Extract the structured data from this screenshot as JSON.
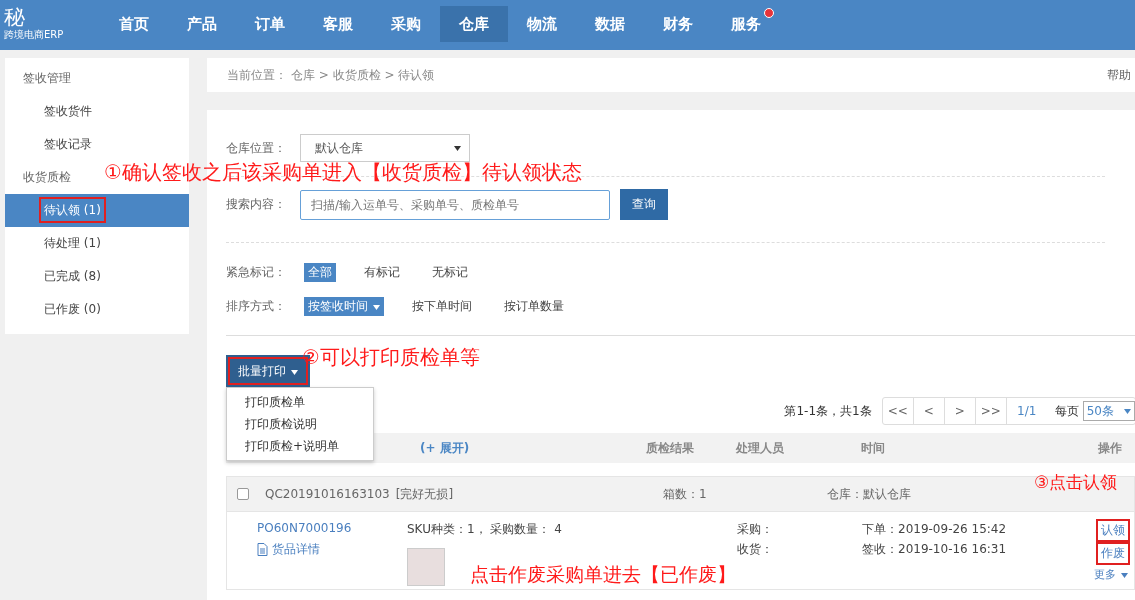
{
  "nav": {
    "logo": "秘",
    "logo_sub": "跨境电商ERP",
    "items": [
      {
        "label": "首页",
        "selected": false,
        "notification": false
      },
      {
        "label": "产品",
        "selected": false,
        "notification": false
      },
      {
        "label": "订单",
        "selected": false,
        "notification": false
      },
      {
        "label": "客服",
        "selected": false,
        "notification": false
      },
      {
        "label": "采购",
        "selected": false,
        "notification": false
      },
      {
        "label": "仓库",
        "selected": true,
        "notification": false
      },
      {
        "label": "物流",
        "selected": false,
        "notification": false
      },
      {
        "label": "数据",
        "selected": false,
        "notification": false
      },
      {
        "label": "财务",
        "selected": false,
        "notification": false
      },
      {
        "label": "服务",
        "selected": false,
        "notification": true
      }
    ]
  },
  "sidebar": {
    "groups": [
      {
        "title": "签收管理",
        "items": [
          {
            "label": "签收货件",
            "selected": false,
            "highlighted": false
          },
          {
            "label": "签收记录",
            "selected": false,
            "highlighted": false
          }
        ]
      },
      {
        "title": "收货质检",
        "items": [
          {
            "label": "待认领 (1)",
            "selected": true,
            "highlighted": true
          },
          {
            "label": "待处理 (1)",
            "selected": false,
            "highlighted": false
          },
          {
            "label": "已完成 (8)",
            "selected": false,
            "highlighted": false
          },
          {
            "label": "已作废 (0)",
            "selected": false,
            "highlighted": false
          }
        ]
      }
    ]
  },
  "breadcrumb": {
    "label": "当前位置：",
    "path": "仓库 > 收货质检 > 待认领",
    "help": "帮助"
  },
  "filters": {
    "warehouse": {
      "label": "仓库位置：",
      "value": "默认仓库"
    },
    "search": {
      "label": "搜索内容：",
      "placeholder": "扫描/输入运单号、采购单号、质检单号",
      "button": "查询"
    },
    "urgency": {
      "label": "紧急标记：",
      "options": [
        {
          "label": "全部",
          "selected": true
        },
        {
          "label": "有标记",
          "selected": false
        },
        {
          "label": "无标记",
          "selected": false
        }
      ]
    },
    "sort": {
      "label": "排序方式：",
      "options": [
        {
          "label": "按签收时间",
          "selected": true
        },
        {
          "label": "按下单时间",
          "selected": false
        },
        {
          "label": "按订单数量",
          "selected": false
        }
      ]
    }
  },
  "batch_print": {
    "label": "批量打印",
    "highlighted": true,
    "expanded": true,
    "menu": [
      "打印质检单",
      "打印质检说明",
      "打印质检+说明单"
    ]
  },
  "pagination": {
    "summary": "第1-1条，共1条",
    "buttons": [
      "<<",
      "<",
      ">",
      ">>"
    ],
    "page": "1/1",
    "per_page_label": "每页",
    "per_page": "50条"
  },
  "table": {
    "columns": [
      "(+ 展开)",
      "质检结果",
      "处理人员",
      "时间",
      "操作"
    ],
    "groups": [
      {
        "checked": false,
        "id": "QC20191016163103",
        "status": "[完好无损]",
        "boxes": "箱数：1",
        "warehouse": "仓库：默认仓库",
        "rows": [
          {
            "po": "PO60N7000196",
            "details_link": "货品详情",
            "sku": "SKU种类：1，  采购数量：  4",
            "purchaser": "采购：",
            "received": "收货：",
            "ordered": "下单：2019-09-26 15:42",
            "signed": "签收：2019-10-16 16:31",
            "actions": [
              {
                "label": "认领",
                "highlighted": true
              },
              {
                "label": "作废",
                "highlighted": true
              }
            ],
            "more": "更多"
          }
        ]
      }
    ]
  },
  "annotations": [
    "①确认签收之后该采购单进入【收货质检】待认领状态",
    "②可以打印质检单等",
    "③点击认领",
    "点击作废采购单进去【已作废】"
  ]
}
